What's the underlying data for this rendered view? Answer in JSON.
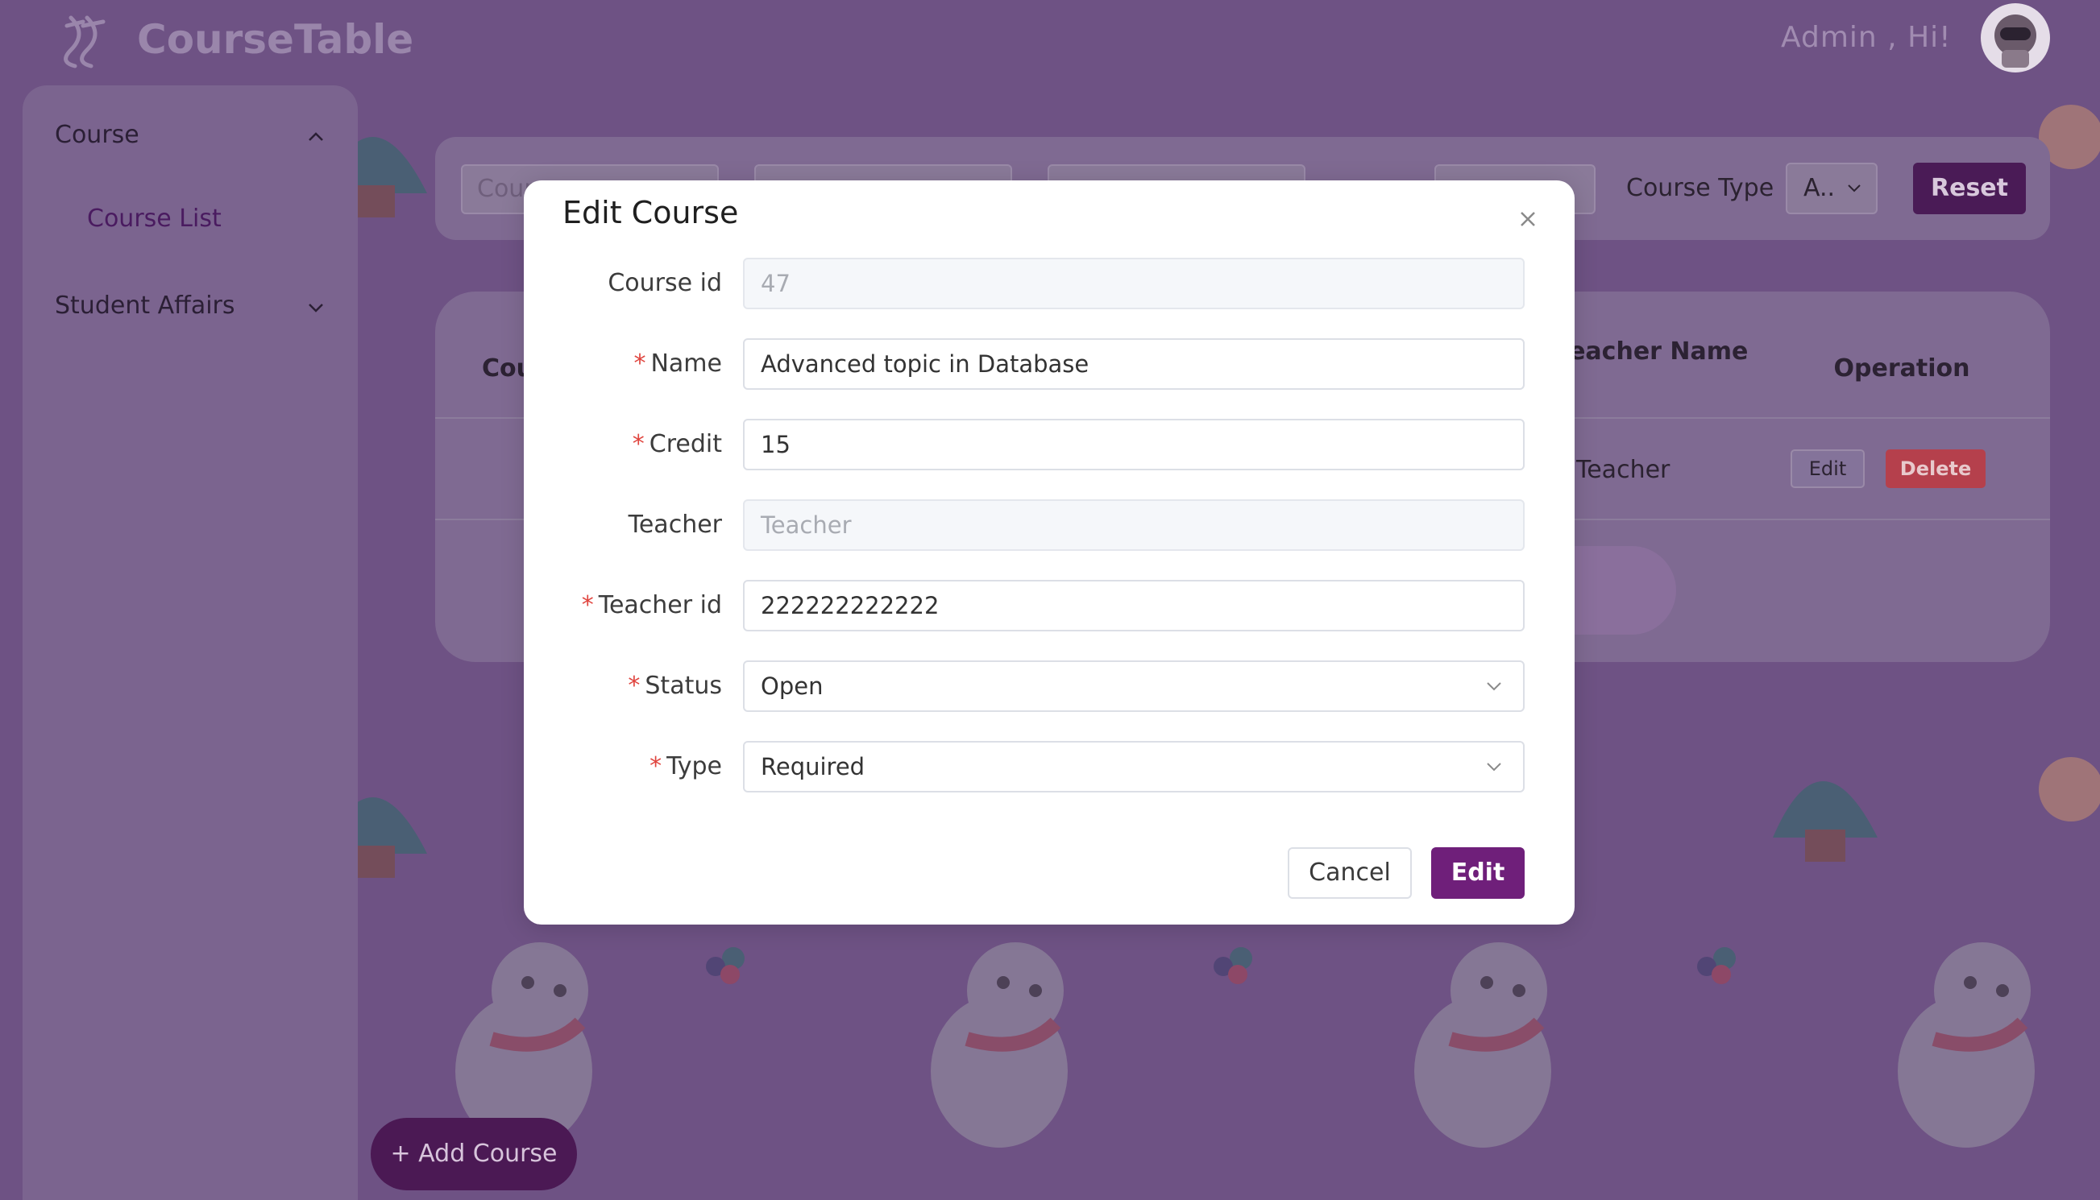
{
  "header": {
    "app_title": "CourseTable",
    "greeting": "Admin , Hi!",
    "logo_icon": "ribbon-logo-icon",
    "avatar_icon": "astronaut-avatar-icon"
  },
  "sidebar": {
    "groups": [
      {
        "label": "Course",
        "expanded": true,
        "items": [
          {
            "label": "Course List"
          }
        ]
      },
      {
        "label": "Student Affairs",
        "expanded": false,
        "items": []
      }
    ]
  },
  "filters": {
    "course_placeholder": "Cour",
    "course_type_label": "Course Type",
    "course_type_value": "A..",
    "reset_label": "Reset"
  },
  "table": {
    "headers": {
      "course": "Cou",
      "teacher_name": "Teacher Name",
      "operation": "Operation"
    },
    "rows": [
      {
        "teacher_name": "Teacher",
        "edit_label": "Edit",
        "delete_label": "Delete"
      }
    ]
  },
  "add_course_label": "+ Add Course",
  "modal": {
    "title": "Edit Course",
    "fields": {
      "course_id": {
        "label": "Course id",
        "value": "47",
        "required": false,
        "disabled": true
      },
      "name": {
        "label": "Name",
        "value": "Advanced topic in Database",
        "required": true
      },
      "credit": {
        "label": "Credit",
        "value": "15",
        "required": true
      },
      "teacher": {
        "label": "Teacher",
        "placeholder": "Teacher",
        "required": false,
        "disabled": true
      },
      "teacher_id": {
        "label": "Teacher id",
        "value": "222222222222",
        "required": true
      },
      "status": {
        "label": "Status",
        "value": "Open",
        "required": true
      },
      "type": {
        "label": "Type",
        "value": "Required",
        "required": true
      }
    },
    "required_mark": "*",
    "cancel_label": "Cancel",
    "submit_label": "Edit"
  },
  "colors": {
    "background": "#6e5284",
    "accent": "#6f1f7a",
    "danger": "#b5404c",
    "required": "#e0453f"
  }
}
